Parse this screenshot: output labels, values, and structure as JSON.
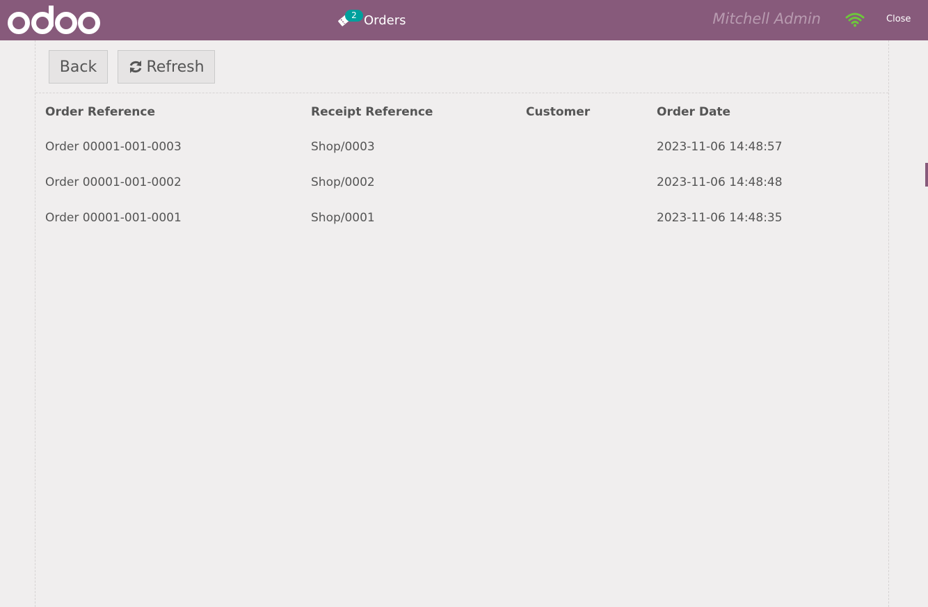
{
  "header": {
    "logo_text": "odoo",
    "orders_label": "Orders",
    "orders_count": "2",
    "cashier_name": "Mitchell Admin",
    "close_label": "Close",
    "connection_icon": "wifi-icon",
    "ticket_icon": "ticket-icon"
  },
  "controls": {
    "back_label": "Back",
    "refresh_label": "Refresh",
    "refresh_icon": "refresh-icon"
  },
  "table": {
    "columns": [
      "Order Reference",
      "Receipt Reference",
      "Customer",
      "Order Date"
    ],
    "rows": [
      {
        "order_ref": "Order 00001-001-0003",
        "receipt_ref": "Shop/0003",
        "customer": "",
        "date": "2023-11-06 14:48:57"
      },
      {
        "order_ref": "Order 00001-001-0002",
        "receipt_ref": "Shop/0002",
        "customer": "",
        "date": "2023-11-06 14:48:48"
      },
      {
        "order_ref": "Order 00001-001-0001",
        "receipt_ref": "Shop/0001",
        "customer": "",
        "date": "2023-11-06 14:48:35"
      }
    ]
  },
  "colors": {
    "brand": "#875a7b",
    "badge": "#00a09d",
    "wifi": "#6ec63c",
    "background": "#f0eeee"
  }
}
